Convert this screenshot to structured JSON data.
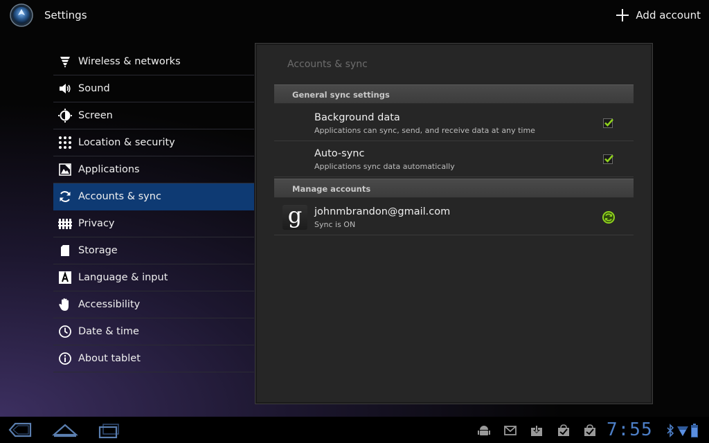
{
  "actionbar": {
    "title": "Settings",
    "add_account_label": "Add account"
  },
  "headers": [
    {
      "label": "Wireless & networks",
      "icon": "wifi-icon"
    },
    {
      "label": "Sound",
      "icon": "speaker-icon"
    },
    {
      "label": "Screen",
      "icon": "brightness-icon"
    },
    {
      "label": "Location & security",
      "icon": "grid-lock-icon"
    },
    {
      "label": "Applications",
      "icon": "applications-icon"
    },
    {
      "label": "Accounts & sync",
      "icon": "sync-icon",
      "selected": true
    },
    {
      "label": "Privacy",
      "icon": "privacy-icon"
    },
    {
      "label": "Storage",
      "icon": "sd-card-icon"
    },
    {
      "label": "Language & input",
      "icon": "language-icon"
    },
    {
      "label": "Accessibility",
      "icon": "hand-icon"
    },
    {
      "label": "Date & time",
      "icon": "clock-icon"
    },
    {
      "label": "About tablet",
      "icon": "info-icon"
    }
  ],
  "panel": {
    "title": "Accounts & sync",
    "general_category": "General sync settings",
    "background_data": {
      "title": "Background data",
      "summary": "Applications can sync, send, and receive data at any time",
      "checked": true
    },
    "auto_sync": {
      "title": "Auto-sync",
      "summary": "Applications sync data automatically",
      "checked": true
    },
    "manage_category": "Manage accounts",
    "account": {
      "icon_letter": "g",
      "email": "johnmbrandon@gmail.com",
      "status": "Sync is ON"
    }
  },
  "systembar": {
    "clock": "7:55"
  },
  "colors": {
    "selected_header": "#0e3a73",
    "checkmark": "#8fd11d",
    "clock": "#4d7fc7",
    "sync_indicator": "#8fd11d"
  }
}
